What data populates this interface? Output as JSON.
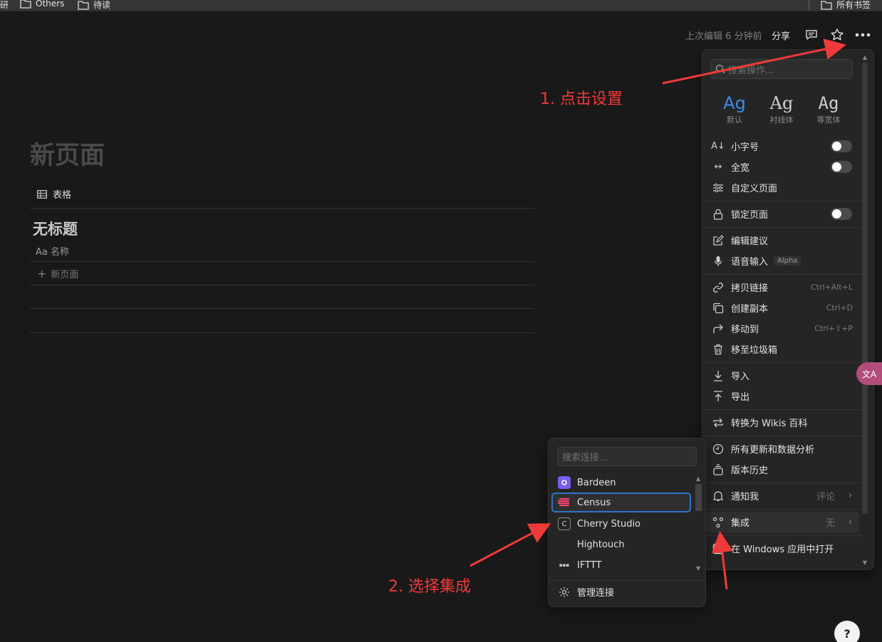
{
  "bookmarks": {
    "partial_left": "研",
    "folders": [
      "Others",
      "待读"
    ],
    "right_folder": "所有书签"
  },
  "topbar": {
    "edited": "上次编辑 6 分钟前",
    "share": "分享"
  },
  "page": {
    "title": "新页面",
    "view_label": "表格",
    "db_title": "无标题",
    "column_label": "Aa 名称",
    "new_page": "新页面"
  },
  "menu": {
    "search_placeholder": "搜索操作...",
    "fonts": [
      {
        "glyph": "Ag",
        "label": "默认"
      },
      {
        "glyph": "Ag",
        "label": "衬线体"
      },
      {
        "glyph": "Ag",
        "label": "等宽体"
      }
    ],
    "small_text": "小字号",
    "full_width": "全宽",
    "customize": "自定义页面",
    "lock_page": "锁定页面",
    "suggest_edits": "编辑建议",
    "voice_input": "语音输入",
    "voice_badge": "Alpha",
    "copy_link": "拷贝链接",
    "copy_link_sc": "Ctrl+Alt+L",
    "duplicate": "创建副本",
    "duplicate_sc": "Ctrl+D",
    "move_to": "移动到",
    "move_to_sc": "Ctrl+⇧+P",
    "trash": "移至垃圾箱",
    "import": "导入",
    "export": "导出",
    "convert_wiki": "转换为 Wikis 百科",
    "updates": "所有更新和数据分析",
    "version_history": "版本历史",
    "notify": "通知我",
    "notify_value": "评论",
    "connections": "集成",
    "connections_value": "无",
    "open_windows": "在 Windows 应用中打开"
  },
  "submenu": {
    "search_placeholder": "搜索连接...",
    "items": [
      "Bardeen",
      "Census",
      "Cherry Studio",
      "Hightouch",
      "IFTTT"
    ],
    "manage": "管理连接"
  },
  "annotations": {
    "step1": "1. 点击设置",
    "step2": "2. 选择集成"
  },
  "colors": {
    "accent": "#2c77c9",
    "annotation": "#f03a3a",
    "background": "#191919"
  }
}
